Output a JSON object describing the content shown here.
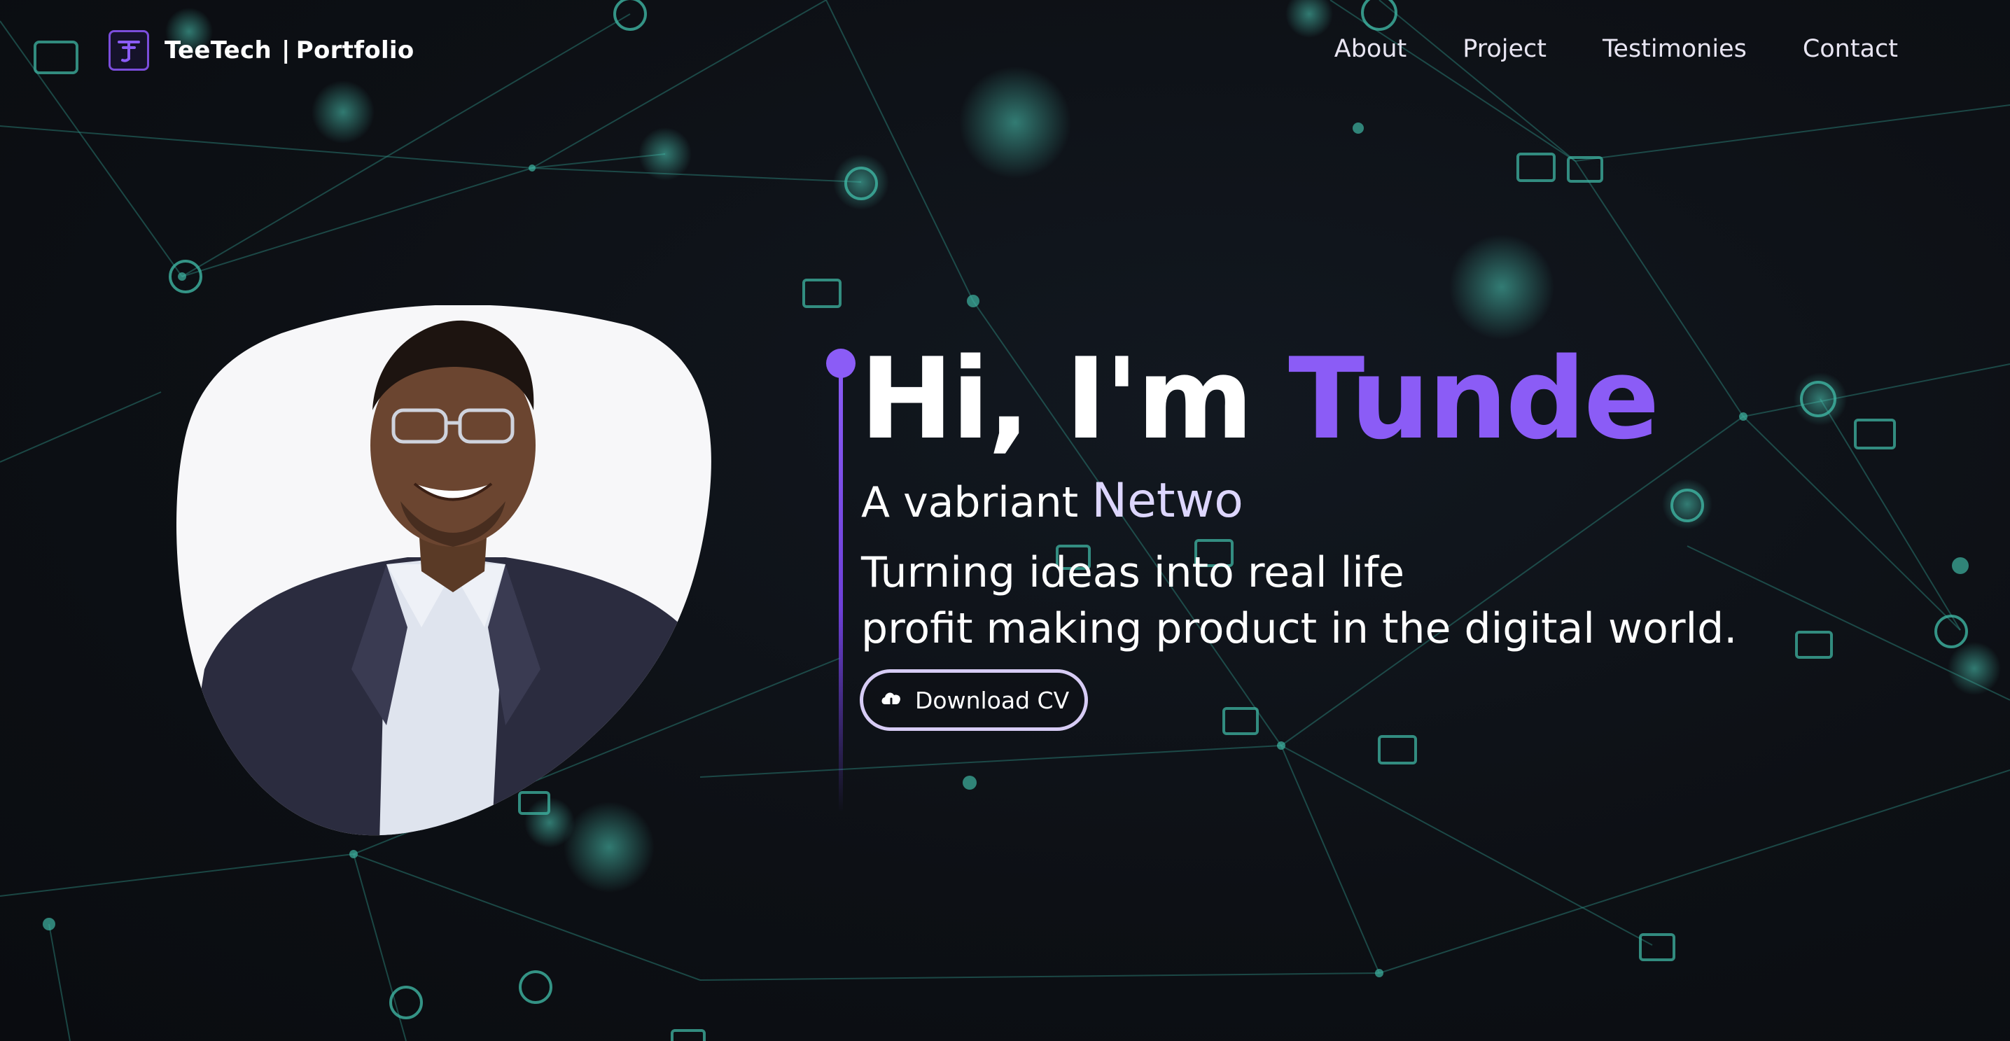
{
  "nav": {
    "brand_name": "TeeTech",
    "brand_separator": "|",
    "brand_suffix": "Portfolio",
    "logo_icon": "tt-monogram-icon",
    "links": [
      {
        "label": "About"
      },
      {
        "label": "Project"
      },
      {
        "label": "Testimonies"
      },
      {
        "label": "Contact"
      }
    ]
  },
  "hero": {
    "greeting": "Hi, I'm ",
    "name": "Tunde",
    "subtitle_prefix": "A vabriant ",
    "subtitle_typed": "Netwo",
    "tagline_line1": "Turning ideas into real life",
    "tagline_line2": "profit making product in the digital world.",
    "cv_button_label": "Download CV",
    "cv_icon": "cloud-download-icon"
  },
  "colors": {
    "accent": "#8b5cf6",
    "background": "#0e1016",
    "network": "#3fb5a3",
    "text": "#ffffff"
  }
}
